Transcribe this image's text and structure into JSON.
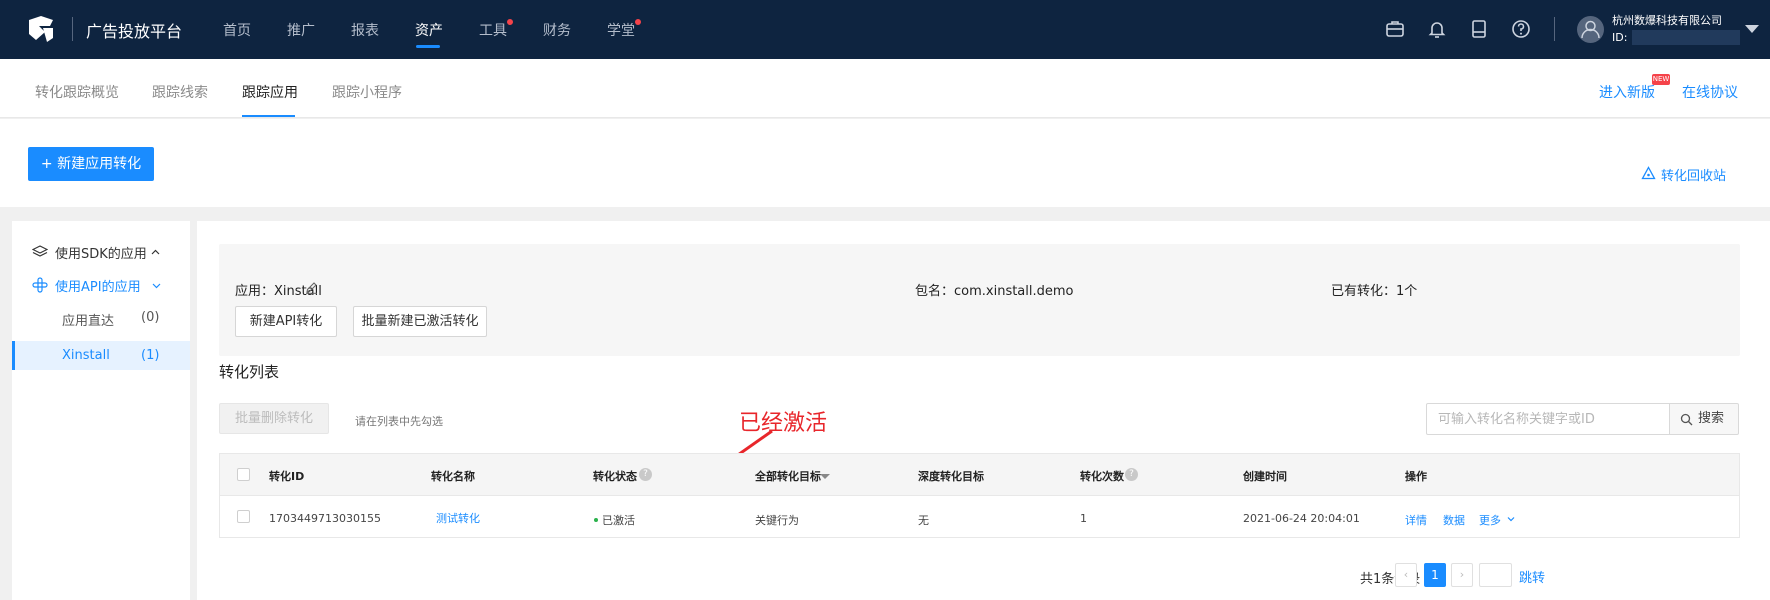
{
  "topbar": {
    "platform_title": "广告投放平台",
    "nav": [
      "首页",
      "推广",
      "报表",
      "资产",
      "工具",
      "财务",
      "学堂"
    ],
    "company": "杭州数爆科技有限公司",
    "id_label": "ID:"
  },
  "subtabs": {
    "tabs": [
      "转化跟踪概览",
      "跟踪线索",
      "跟踪应用",
      "跟踪小程序"
    ],
    "new_version": "进入新版",
    "new_badge": "NEW",
    "agreement": "在线协议"
  },
  "actions": {
    "create_button": "+ 新建应用转化",
    "recycle": "转化回收站"
  },
  "sidebar": {
    "sdk_group": "使用SDK的应用",
    "api_group": "使用API的应用",
    "items": [
      {
        "label": "应用直达",
        "count": "(0)"
      },
      {
        "label": "Xinstall",
        "count": "(1)"
      }
    ]
  },
  "app_card": {
    "app": "应用：Xinstall",
    "package": "包名：com.xinstall.demo",
    "existing": "已有转化：1个",
    "btn_new_api": "新建API转化",
    "btn_batch": "批量新建已激活转化"
  },
  "list": {
    "title": "转化列表",
    "batch_delete": "批量删除转化",
    "hint": "请在列表中先勾选",
    "search_placeholder": "可输入转化名称关键字或ID",
    "search_button": "搜索",
    "annotation": "已经激活"
  },
  "table": {
    "headers": [
      "转化ID",
      "转化名称",
      "转化状态",
      "全部转化目标",
      "深度转化目标",
      "转化次数",
      "创建时间",
      "操作"
    ],
    "row": {
      "id": "1703449713030155",
      "name": "测试转化",
      "status": "已激活",
      "target": "关键行为",
      "deep_target": "无",
      "count": "1",
      "created": "2021-06-24 20:04:01",
      "op_detail": "详情",
      "op_data": "数据",
      "op_more": "更多"
    }
  },
  "pagination": {
    "total": "共1条记录",
    "prev": "‹",
    "current": "1",
    "next": "›",
    "jump": "跳转"
  },
  "colors": {
    "topbar": "#0e2440",
    "accent": "#1a8cff",
    "annotation": "#e8262b",
    "status_active": "#2bb24c"
  }
}
